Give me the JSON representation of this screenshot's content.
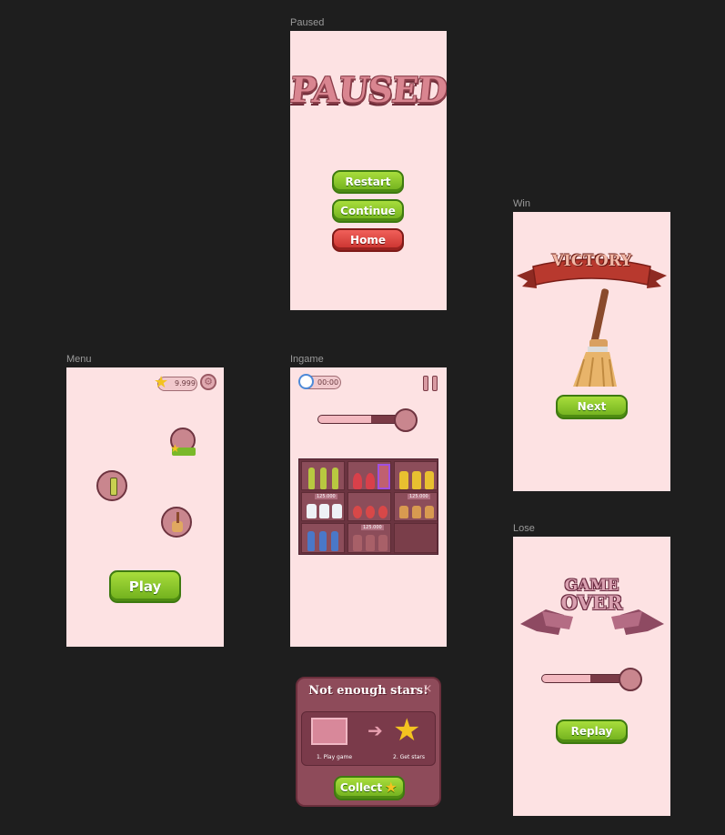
{
  "frames": {
    "paused": {
      "label": "Paused",
      "title": "PAUSED",
      "buttons": {
        "restart": "Restart",
        "continue": "Continue",
        "home": "Home"
      }
    },
    "win": {
      "label": "Win",
      "banner": "VICTORY",
      "next": "Next"
    },
    "menu": {
      "label": "Menu",
      "stars": "9.999",
      "play": "Play"
    },
    "ingame": {
      "label": "Ingame",
      "timer": "00:00",
      "progress": 0.6,
      "price_tags": [
        "125.000",
        "125.000",
        "125.000",
        "125.000"
      ]
    },
    "lose": {
      "label": "Lose",
      "title_line1": "GAME",
      "title_line2": "OVER",
      "progress": 0.55,
      "replay": "Replay"
    },
    "popup": {
      "title": "Not enough stars!",
      "step1": "1. Play game",
      "step2": "2. Get stars",
      "collect": "Collect"
    }
  },
  "colors": {
    "canvas": "#1e1e1e",
    "screen": "#fde2e3",
    "green": "#7dbf22",
    "red": "#d8413c",
    "maroon": "#8e4b5a"
  }
}
